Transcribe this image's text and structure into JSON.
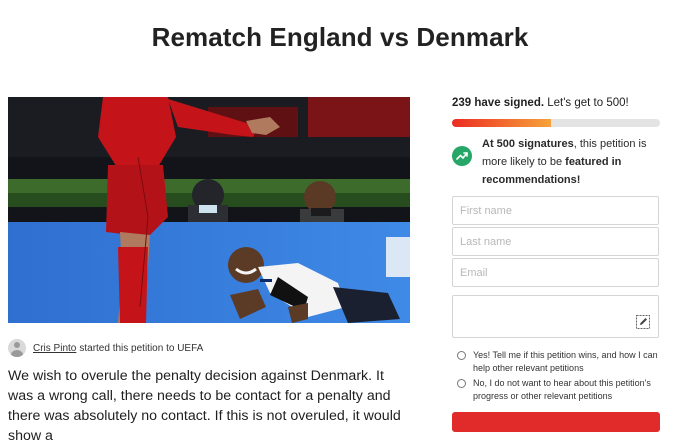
{
  "petition": {
    "title": "Rematch England vs Denmark",
    "starter_name": "Cris Pinto",
    "starter_action": "started this petition to UEFA",
    "description": "We wish to overule the penalty decision against Denmark. It was a wrong call, there needs to be contact for a penalty and there was absolutely no contact. If this is not overuled, it would show a"
  },
  "signatures": {
    "count_text": "239 have signed.",
    "goal_text": "Let's get to 500!",
    "progress_fraction": 0.478
  },
  "milestone": {
    "bold1": "At 500 signatures",
    "text1": ", this petition is more likely to be ",
    "bold2": "featured in recommendations!",
    "icon": "trending-up-icon"
  },
  "form": {
    "first_name_placeholder": "First name",
    "last_name_placeholder": "Last name",
    "email_placeholder": "Email",
    "comment_icon": "pencil-icon",
    "opt_in_yes": "Yes! Tell me if this petition wins, and how I can help other relevant petitions",
    "opt_in_no": "No, I do not want to hear about this petition's progress or other relevant petitions"
  },
  "colors": {
    "progress_start": "#ec2c22",
    "progress_end": "#f6a33a",
    "accent_green": "#26a667",
    "sign_button": "#e12b2b"
  }
}
